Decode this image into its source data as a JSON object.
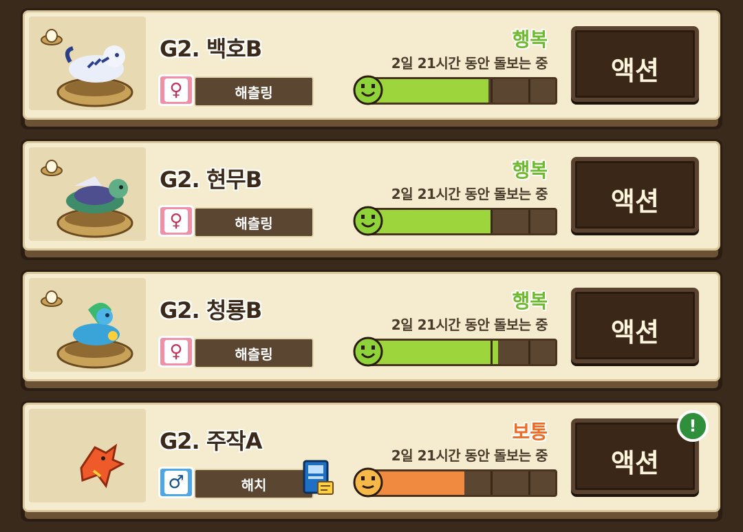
{
  "colors": {
    "happy": "#6eb92e",
    "normal": "#ef6a22",
    "bar_green": "#9dd63c",
    "bar_orange": "#f08a40",
    "button_bg": "#3b2718"
  },
  "cards": [
    {
      "name": "G2. 백호B",
      "gender": "female",
      "gender_symbol": "♀",
      "stage": "해츨링",
      "mood": "행복",
      "mood_color": "#6eb92e",
      "timer": "2일 21시간 동안 돌보는 중",
      "bar_fraction": 0.65,
      "bar_color": "#9dd63c",
      "action": "액션",
      "has_egg_icon": true,
      "has_book_icon": false,
      "has_alert": false,
      "pet_icon": "white-tiger-icon"
    },
    {
      "name": "G2. 현무B",
      "gender": "female",
      "gender_symbol": "♀",
      "stage": "해츨링",
      "mood": "행복",
      "mood_color": "#6eb92e",
      "timer": "2일 21시간 동안 돌보는 중",
      "bar_fraction": 0.67,
      "bar_color": "#9dd63c",
      "action": "액션",
      "has_egg_icon": true,
      "has_book_icon": false,
      "has_alert": false,
      "pet_icon": "black-tortoise-icon"
    },
    {
      "name": "G2. 청룡B",
      "gender": "female",
      "gender_symbol": "♀",
      "stage": "해츨링",
      "mood": "행복",
      "mood_color": "#6eb92e",
      "timer": "2일 21시간 동안 돌보는 중",
      "bar_fraction": 0.7,
      "bar_color": "#9dd63c",
      "action": "액션",
      "has_egg_icon": true,
      "has_book_icon": false,
      "has_alert": false,
      "pet_icon": "azure-dragon-icon"
    },
    {
      "name": "G2. 주작A",
      "gender": "male",
      "gender_symbol": "♂",
      "stage": "해치",
      "mood": "보통",
      "mood_color": "#ef6a22",
      "timer": "2일 21시간 동안 돌보는 중",
      "bar_fraction": 0.52,
      "bar_color": "#f08a40",
      "action": "액션",
      "has_egg_icon": false,
      "has_book_icon": true,
      "has_alert": true,
      "alert_text": "!",
      "pet_icon": "vermilion-bird-icon"
    }
  ]
}
